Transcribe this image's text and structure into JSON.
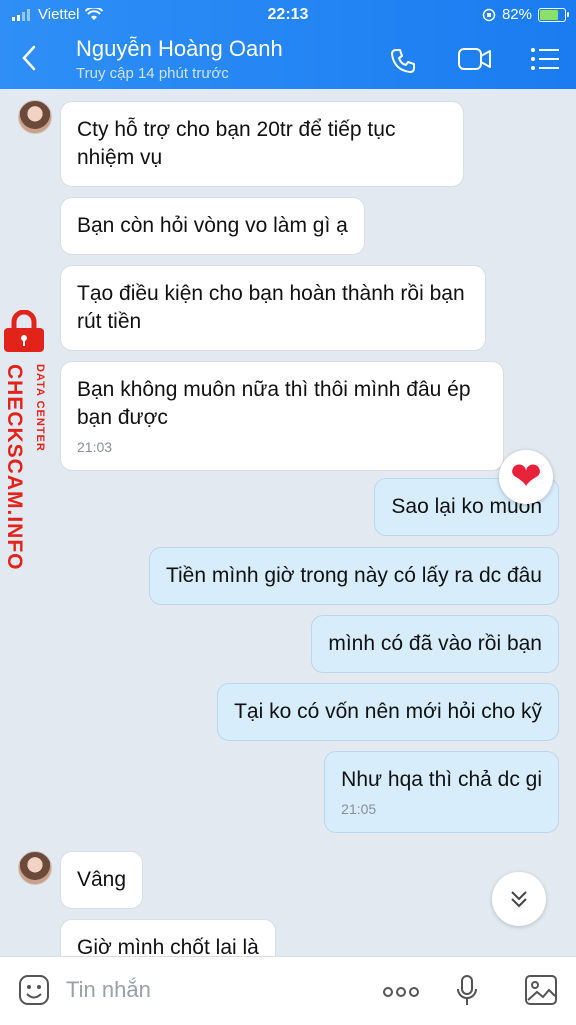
{
  "status_bar": {
    "carrier": "Viettel",
    "time": "22:13",
    "battery_percent": "82%",
    "battery_level": 0.82
  },
  "header": {
    "contact_name": "Nguyễn Hoàng Oanh",
    "last_seen": "Truy cập 14 phút trước",
    "icons": [
      "back-chevron-icon",
      "phone-icon",
      "video-call-icon",
      "menu-list-icon"
    ]
  },
  "messages": [
    {
      "direction": "in",
      "text": "Cty hỗ trợ cho bạn 20tr để tiếp tục nhiệm vụ"
    },
    {
      "direction": "in",
      "text": "Bạn còn hỏi vòng vo làm gì ạ"
    },
    {
      "direction": "in",
      "text": "Tạo điều kiện cho bạn hoàn thành rồi bạn rút tiền"
    },
    {
      "direction": "in",
      "text": "Bạn không muôn nữa thì thôi mình đâu ép bạn được",
      "time": "21:03"
    },
    {
      "direction": "out",
      "text": "Sao lại ko muốn",
      "reaction": "heart"
    },
    {
      "direction": "out",
      "text": "Tiền mình giờ trong này có lấy ra dc đâu"
    },
    {
      "direction": "out",
      "text": "mình có đã vào rồi bạn"
    },
    {
      "direction": "out",
      "text": "Tại ko có vốn nên mới hỏi cho kỹ"
    },
    {
      "direction": "out",
      "text": "Như hqa thì chả dc gi",
      "time": "21:05"
    },
    {
      "direction": "in",
      "text": "Vâng"
    },
    {
      "direction": "in",
      "text": "Giờ mình chốt lai là"
    }
  ],
  "watermark": {
    "main": "CHECKSCAM.INFO",
    "sub": "DATA CENTER"
  },
  "composer": {
    "placeholder": "Tin nhắn",
    "icons": [
      "sticker-icon",
      "more-icon",
      "microphone-icon",
      "image-icon"
    ]
  },
  "colors": {
    "header": "#1a7cf0",
    "outgoing_bubble": "#d7edfc",
    "incoming_bubble": "#ffffff",
    "watermark": "#e2231a"
  }
}
